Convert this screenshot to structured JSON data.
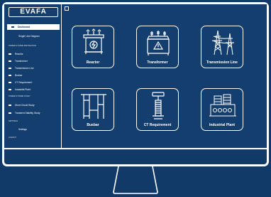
{
  "app": {
    "logo": "EVAFA"
  },
  "sidebar": {
    "dashboard": "Dashboard",
    "single_line": "Single Line Diagram",
    "section_protection": "POWER SYSTEM PROTECTION",
    "protection_items": [
      "Reactor",
      "Transformer",
      "Transmission Line",
      "Busbar",
      "CT Requirement",
      "Industrial Plant"
    ],
    "section_study": "POWER SYSTEM STUDY",
    "study_items": [
      "Short Circuit Study",
      "Transient Stability Study"
    ],
    "section_settings": "SETTINGS",
    "settings": "Settings",
    "logout": "LOGOUT"
  },
  "cards": [
    {
      "label": "Reactor",
      "icon": "reactor-icon"
    },
    {
      "label": "Transformer",
      "icon": "transformer-icon"
    },
    {
      "label": "Transmission Line",
      "icon": "transmission-tower-icon"
    },
    {
      "label": "Busbar",
      "icon": "busbar-icon"
    },
    {
      "label": "CT Requirement",
      "icon": "ct-requirement-icon"
    },
    {
      "label": "Industrial Plant",
      "icon": "industrial-plant-icon"
    }
  ],
  "colors": {
    "background": "#113a68",
    "screen": "#143e6d",
    "bezel": "#ffffff"
  }
}
